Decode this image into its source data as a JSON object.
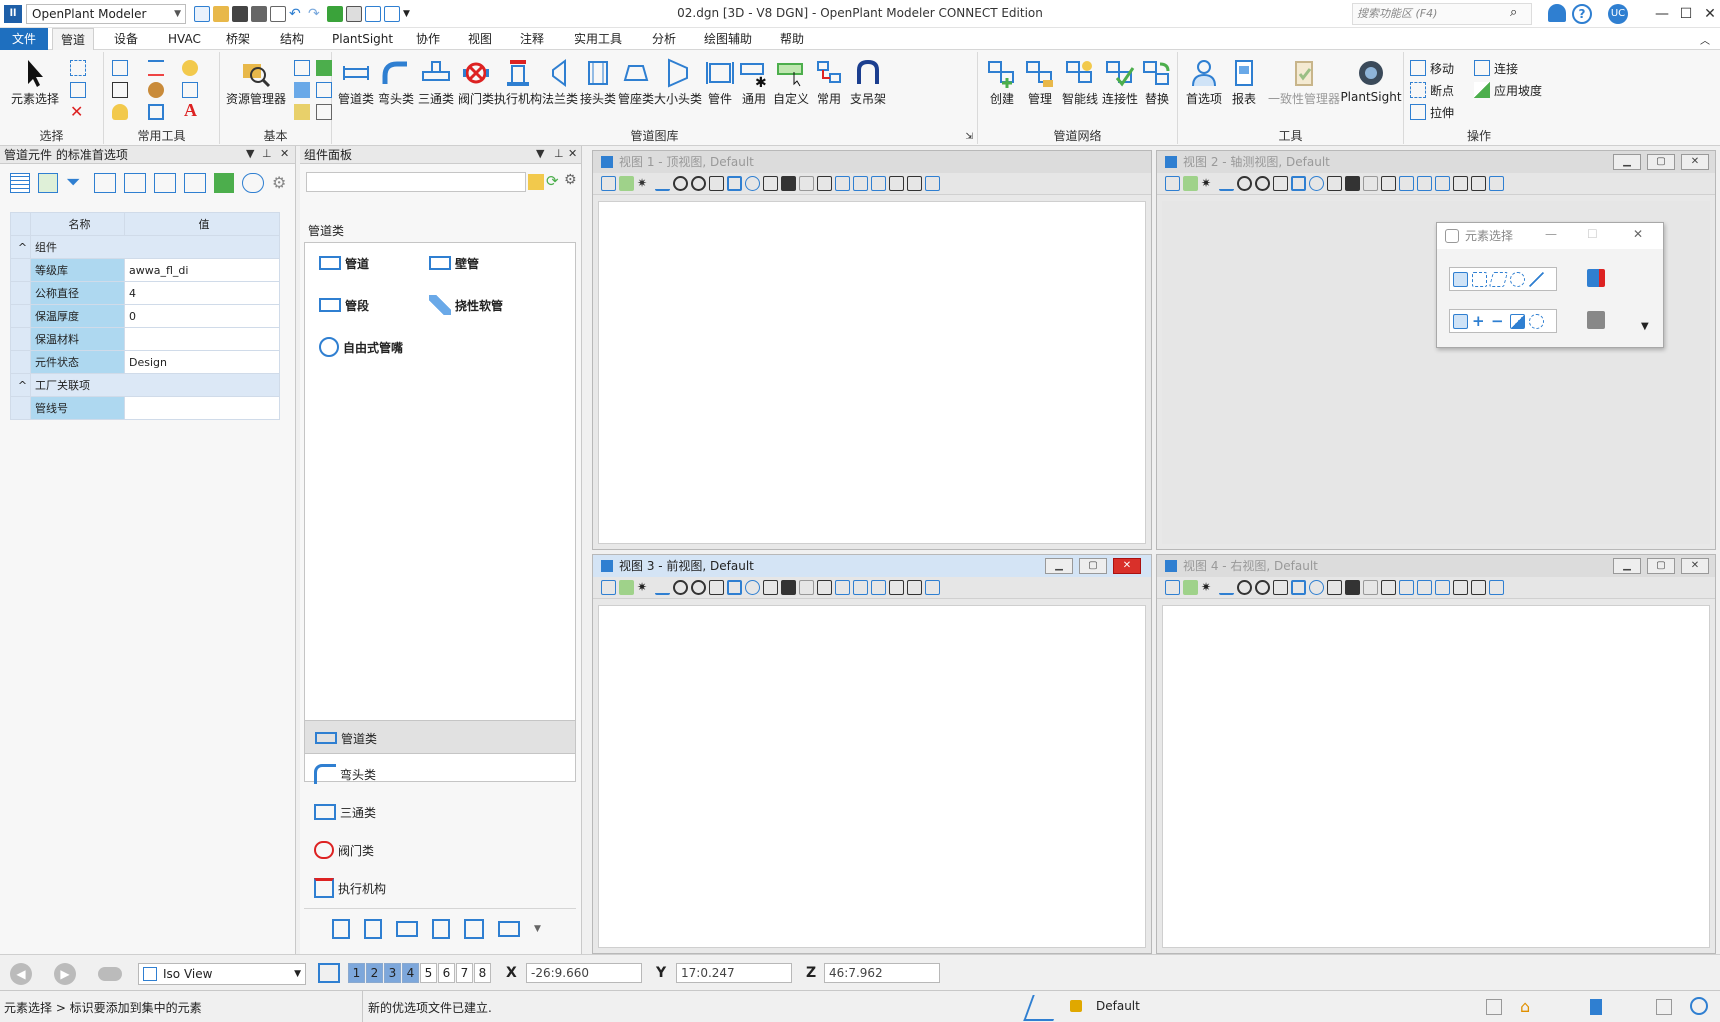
{
  "app": {
    "selector": "OpenPlant Modeler",
    "window_title": "02.dgn [3D - V8 DGN] - OpenPlant Modeler CONNECT Edition",
    "search_placeholder": "搜索功能区 (F4)",
    "user": "UC"
  },
  "menu": [
    "文件",
    "管道",
    "设备",
    "HVAC",
    "桥架",
    "结构",
    "PlantSight",
    "协作",
    "视图",
    "注释",
    "实用工具",
    "分析",
    "绘图辅助",
    "帮助"
  ],
  "ribbon": {
    "select": {
      "label": "选择",
      "btn": "元素选择"
    },
    "common": {
      "label": "常用工具"
    },
    "basic": {
      "label": "基本",
      "btn": "资源管理器"
    },
    "library": {
      "label": "管道图库",
      "items": [
        "管道类",
        "弯头类",
        "三通类",
        "阀门类",
        "执行机构",
        "法兰类",
        "接头类",
        "管座类",
        "大小头类",
        "管件",
        "通用",
        "自定义",
        "常用",
        "支吊架"
      ]
    },
    "network": {
      "label": "管道网络",
      "items": [
        "创建",
        "管理",
        "智能线",
        "连接性",
        "替换"
      ]
    },
    "tools": {
      "label": "工具",
      "items": [
        "首选项",
        "报表",
        "一致性管理器",
        "PlantSight"
      ]
    },
    "ops": {
      "label": "操作",
      "items": [
        "移动",
        "连接",
        "断点",
        "应用坡度",
        "拉伸"
      ]
    }
  },
  "left_panel": {
    "title": "管道元件 的标准首选项",
    "col_name": "名称",
    "col_value": "值",
    "sections": [
      {
        "name": "组件",
        "rows": [
          [
            "等级库",
            "awwa_fl_di"
          ],
          [
            "公称直径",
            "4"
          ],
          [
            "保温厚度",
            "0"
          ],
          [
            "保温材料",
            ""
          ],
          [
            "元件状态",
            "Design"
          ]
        ]
      },
      {
        "name": "工厂关联项",
        "rows": [
          [
            "管线号",
            ""
          ]
        ]
      }
    ]
  },
  "comp_panel": {
    "title": "组件面板",
    "category": "管道类",
    "grid": [
      "管道",
      "壁管",
      "管段",
      "挠性软管",
      "自由式管嘴"
    ],
    "list": [
      "管道类",
      "弯头类",
      "三通类",
      "阀门类",
      "执行机构"
    ]
  },
  "views": [
    {
      "title": "视图 1 - 顶视图, Default"
    },
    {
      "title": "视图 2 - 轴测视图, Default"
    },
    {
      "title": "视图 3 - 前视图, Default"
    },
    {
      "title": "视图 4 - 右视图, Default"
    }
  ],
  "element_select": {
    "title": "元素选择"
  },
  "viewbar": {
    "view_mode": "Iso View",
    "view_nums": [
      "1",
      "2",
      "3",
      "4",
      "5",
      "6",
      "7",
      "8"
    ],
    "x_label": "X",
    "x": "-26:9.660",
    "y_label": "Y",
    "y": "17:0.247",
    "z_label": "Z",
    "z": "46:7.962"
  },
  "status": {
    "left": "元素选择 > 标识要添加到集中的元素",
    "msg": "新的优选项文件已建立.",
    "model": "Default"
  },
  "colors": {
    "accent": "#1e6fbf",
    "pipe_blue": "#2f7fd1"
  }
}
